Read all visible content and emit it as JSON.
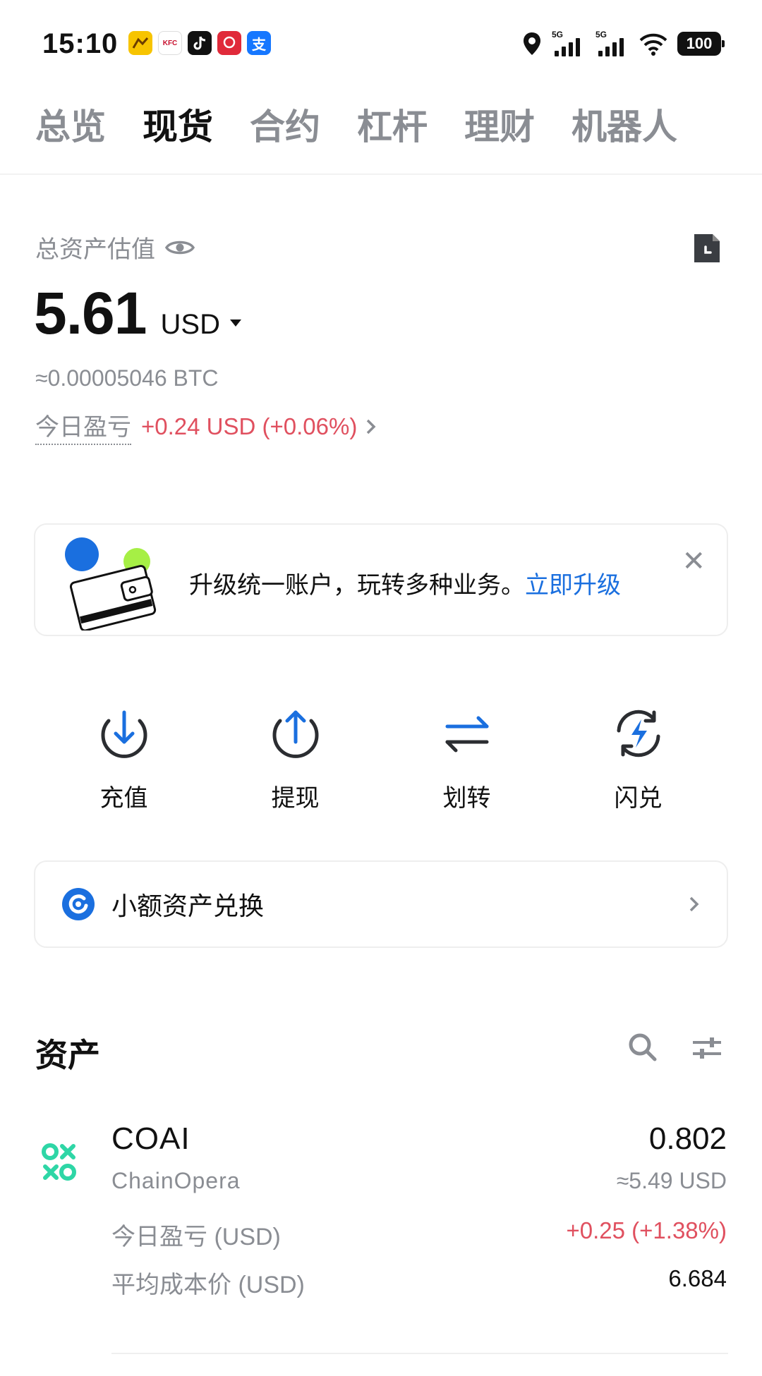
{
  "status_bar": {
    "time": "15:10",
    "apps": [
      {
        "name": "meituan-app-icon",
        "color": "#f7c400"
      },
      {
        "name": "kfc-app-icon",
        "label": "KFC",
        "color": "#c8102e"
      },
      {
        "name": "tiktok-app-icon",
        "color": "#111111"
      },
      {
        "name": "app-red-icon",
        "color": "#e02a3a"
      },
      {
        "name": "alipay-app-icon",
        "label": "支",
        "color": "#1677ff"
      }
    ],
    "signal_tags": [
      "5G",
      "5G"
    ],
    "battery": "100"
  },
  "tabs": [
    {
      "label": "总览",
      "active": false
    },
    {
      "label": "现货",
      "active": true
    },
    {
      "label": "合约",
      "active": false
    },
    {
      "label": "杠杆",
      "active": false
    },
    {
      "label": "理财",
      "active": false
    },
    {
      "label": "机器人",
      "active": false
    }
  ],
  "summary": {
    "label": "总资产估值",
    "balance": "5.61",
    "unit": "USD",
    "btc_equiv": "≈0.00005046 BTC",
    "pnl_label": "今日盈亏",
    "pnl_value": "+0.24 USD (+0.06%)"
  },
  "banner": {
    "text": "升级统一账户，玩转多种业务。",
    "link": "立即升级",
    "close": "✕"
  },
  "actions": [
    {
      "label": "充值",
      "icon": "deposit-icon"
    },
    {
      "label": "提现",
      "icon": "withdraw-icon"
    },
    {
      "label": "划转",
      "icon": "transfer-icon"
    },
    {
      "label": "闪兑",
      "icon": "flash-swap-icon"
    }
  ],
  "convert": {
    "label": "小额资产兑换",
    "chevron": "›"
  },
  "assets": {
    "title": "资产",
    "items": [
      {
        "symbol": "COAI",
        "name": "ChainOpera",
        "amount": "0.802",
        "value": "≈5.49 USD",
        "pnl_label": "今日盈亏 (USD)",
        "pnl_value": "+0.25 (+1.38%)",
        "cost_label": "平均成本价 (USD)",
        "cost_value": "6.684"
      }
    ]
  },
  "colors": {
    "accent": "#1a6fdf",
    "positive": "#e0505f",
    "muted": "#8a8d93",
    "coin": "#2ed6a6"
  }
}
